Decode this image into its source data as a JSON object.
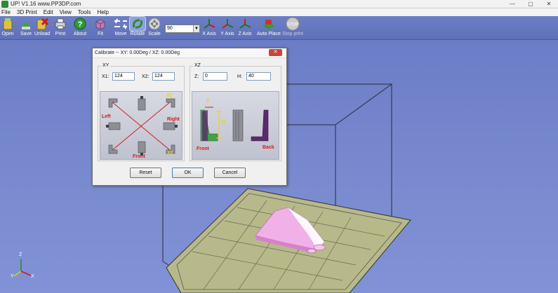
{
  "window": {
    "title": "UP!  V1.16   www.PP3DP.com",
    "minimize": "—",
    "maximize": "▢",
    "close": "✕"
  },
  "menu": [
    "File",
    "3D Print",
    "Edit",
    "View",
    "Tools",
    "Help"
  ],
  "toolbar": {
    "open": "Open",
    "save": "Save",
    "unload": "Unload",
    "print": "Print",
    "about": "About",
    "fit": "Fit",
    "move": "Move",
    "rotate": "Rotate",
    "scale": "Scale",
    "scale_value": "90",
    "x_axis": "X Axis",
    "y_axis": "Y Axis",
    "z_axis": "Z Axis",
    "auto_place": "Auto Place",
    "stop_print": "Stop print",
    "stop_icon_text": "STOP"
  },
  "dialog": {
    "title": "Calibrate -- XY: 0.00Deg  /  XZ: 0.00Deg",
    "close": "✕",
    "xy": {
      "group_label": "XY",
      "x1_label": "X1:",
      "x1_value": "124",
      "x2_label": "X2:",
      "x2_value": "124",
      "labels": {
        "x1": "X1",
        "x2": "X2",
        "left": "Left",
        "right": "Right",
        "front": "Front"
      }
    },
    "xz": {
      "group_label": "XZ",
      "z_label": "Z:",
      "z_value": "0",
      "h_label": "H:",
      "h_value": "40",
      "labels": {
        "z": "Z",
        "h": "H",
        "front": "Front",
        "back": "Back"
      }
    },
    "buttons": {
      "reset": "Reset",
      "ok": "OK",
      "cancel": "Cancel"
    }
  },
  "viewport": {
    "axis": {
      "z": "Z",
      "y": "Y",
      "x": "X"
    }
  },
  "colors": {
    "background": "#6a7cc4",
    "platform": "#b8b98a",
    "model": "#f0a8e6",
    "label_red": "#d21c1c",
    "label_yellow": "#f2d200"
  }
}
